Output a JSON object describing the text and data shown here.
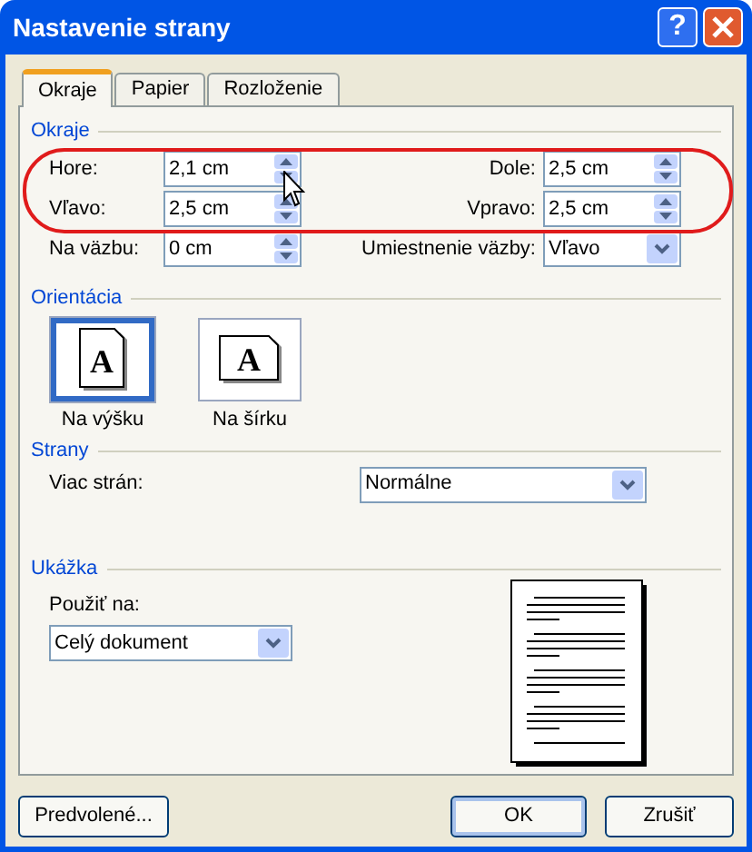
{
  "window": {
    "title": "Nastavenie strany",
    "help_button": "?"
  },
  "tabs": [
    {
      "label": "Okraje",
      "selected": true
    },
    {
      "label": "Papier",
      "selected": false
    },
    {
      "label": "Rozloženie",
      "selected": false
    }
  ],
  "margins": {
    "title": "Okraje",
    "rows": [
      [
        {
          "kind": "spin",
          "label": "Hore:",
          "value": "2,1 cm"
        },
        {
          "kind": "spin",
          "label": "Dole:",
          "value": "2,5 cm"
        }
      ],
      [
        {
          "kind": "spin",
          "label": "Vľavo:",
          "value": "2,5 cm"
        },
        {
          "kind": "spin",
          "label": "Vpravo:",
          "value": "2,5 cm"
        }
      ],
      [
        {
          "kind": "spin",
          "label": "Na väzbu:",
          "value": "0 cm"
        },
        {
          "kind": "dropdown",
          "label": "Umiestnenie väzby:",
          "value": "Vľavo"
        }
      ]
    ]
  },
  "orientation": {
    "title": "Orientácia",
    "options": [
      {
        "label": "Na výšku",
        "glyph": "A",
        "selected": true
      },
      {
        "label": "Na šírku",
        "glyph": "A",
        "selected": false
      }
    ]
  },
  "pages": {
    "title": "Strany",
    "label": "Viac strán:",
    "value": "Normálne"
  },
  "preview": {
    "title": "Ukážka",
    "apply_label": "Použiť na:",
    "apply_value": "Celý dokument"
  },
  "buttons": [
    {
      "label": "Predvolené...",
      "default": false
    },
    {
      "label": "OK",
      "default": true
    },
    {
      "label": "Zrušiť",
      "default": false
    }
  ]
}
